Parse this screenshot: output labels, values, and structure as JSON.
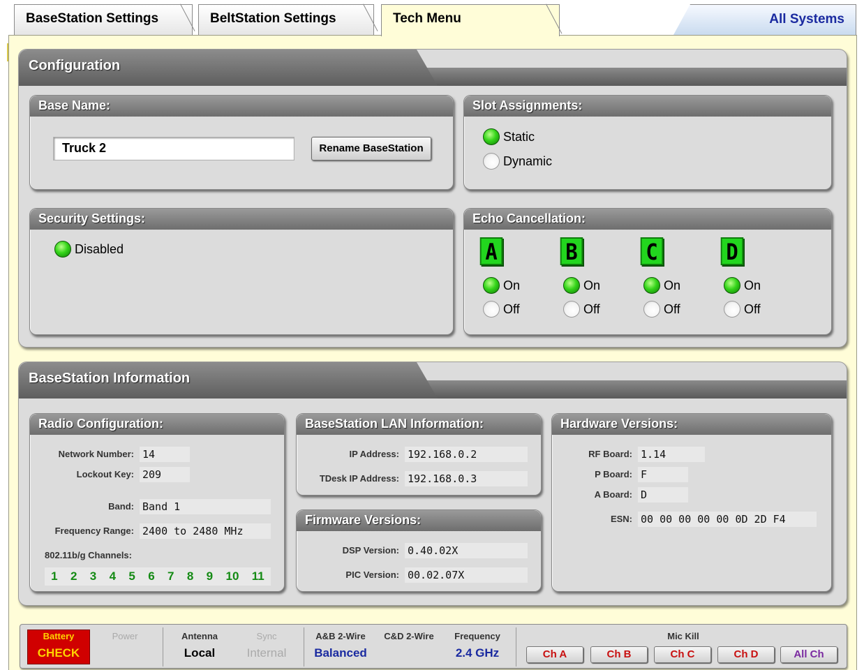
{
  "tabs": [
    "BaseStation Settings",
    "BeltStation Settings",
    "Tech Menu"
  ],
  "all_systems": "All Systems",
  "configuration": {
    "title": "Configuration",
    "base_name": {
      "title": "Base Name:",
      "value": "Truck 2",
      "button": "Rename BaseStation"
    },
    "slot": {
      "title": "Slot Assignments:",
      "options": [
        "Static",
        "Dynamic"
      ],
      "selected": "Static"
    },
    "security": {
      "title": "Security Settings:",
      "option": "Disabled"
    },
    "echo": {
      "title": "Echo Cancellation:",
      "channels": [
        {
          "letter": "A",
          "on": "On",
          "off": "Off",
          "selected": "On"
        },
        {
          "letter": "B",
          "on": "On",
          "off": "Off",
          "selected": "On"
        },
        {
          "letter": "C",
          "on": "On",
          "off": "Off",
          "selected": "On"
        },
        {
          "letter": "D",
          "on": "On",
          "off": "Off",
          "selected": "On"
        }
      ]
    }
  },
  "info": {
    "title": "BaseStation Information",
    "radio": {
      "title": "Radio Configuration:",
      "network_label": "Network Number:",
      "network": "14",
      "lockout_label": "Lockout Key:",
      "lockout": "209",
      "band_label": "Band:",
      "band": "Band 1",
      "freq_label": "Frequency Range:",
      "freq": "2400 to 2480 MHz",
      "channels_label": "802.11b/g Channels:",
      "channels": [
        "1",
        "2",
        "3",
        "4",
        "5",
        "6",
        "7",
        "8",
        "9",
        "10",
        "11"
      ]
    },
    "lan": {
      "title": "BaseStation LAN Information:",
      "ip_label": "IP Address:",
      "ip": "192.168.0.2",
      "tdesk_label": "TDesk IP Address:",
      "tdesk": "192.168.0.3"
    },
    "firmware": {
      "title": "Firmware Versions:",
      "dsp_label": "DSP Version:",
      "dsp": "0.40.02X",
      "pic_label": "PIC Version:",
      "pic": "00.02.07X"
    },
    "hardware": {
      "title": "Hardware Versions:",
      "rf_label": "RF Board:",
      "rf": "1.14",
      "p_label": "P Board:",
      "p": "F",
      "a_label": "A Board:",
      "a": "D",
      "esn_label": "ESN:",
      "esn": "00 00 00 00 00 0D 2D F4"
    }
  },
  "status": {
    "battery_label": "Battery",
    "battery_value": "CHECK",
    "power_label": "Power",
    "antenna_label": "Antenna",
    "antenna_value": "Local",
    "sync_label": "Sync",
    "sync_value": "Internal",
    "ab_label": "A&B 2-Wire",
    "cd_label": "C&D 2-Wire",
    "wire_value": "Balanced",
    "freq_label": "Frequency",
    "freq_value": "2.4 GHz",
    "mic_kill_label": "Mic Kill",
    "mic_buttons": [
      "Ch A",
      "Ch B",
      "Ch C",
      "Ch D",
      "All Ch"
    ]
  },
  "colors": {
    "accent_green": "#22d61e",
    "battery_red": "#d00000",
    "link_blue": "#1a2aa0",
    "panel_yellow": "#fffdd8"
  }
}
